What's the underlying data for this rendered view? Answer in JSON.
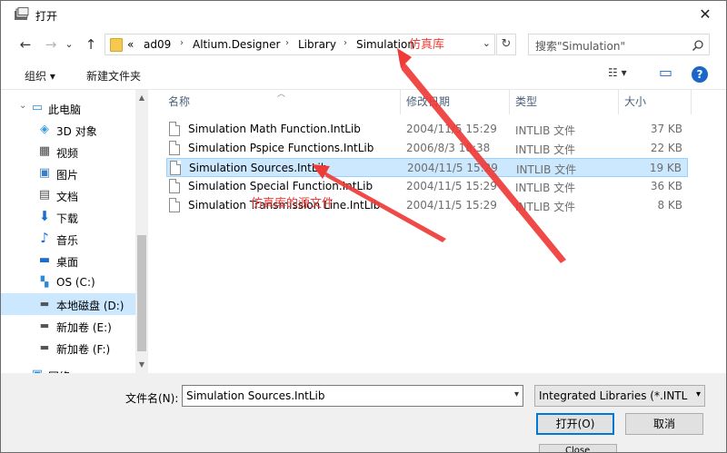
{
  "window": {
    "title": "打开",
    "close_glyph": "✕"
  },
  "nav": {
    "back": "←",
    "forward": "→",
    "history": "⌄",
    "up": "↑",
    "breadcrumb": [
      "«",
      "ad09",
      "Altium.Designer",
      "Library",
      "Simulation"
    ],
    "breadcrumb_sep": "›",
    "refresh": "↻",
    "search_placeholder": "搜索\"Simulation\""
  },
  "toolbar": {
    "organize": "组织 ▾",
    "new_folder": "新建文件夹",
    "view": "☷ ▾",
    "pane": "▭",
    "help": "?"
  },
  "sidebar": {
    "items": [
      {
        "label": "此电脑",
        "icon": "computer-icon"
      },
      {
        "label": "3D 对象",
        "icon": "cube-icon"
      },
      {
        "label": "视频",
        "icon": "film-icon"
      },
      {
        "label": "图片",
        "icon": "picture-icon"
      },
      {
        "label": "文档",
        "icon": "document-icon"
      },
      {
        "label": "下载",
        "icon": "download-icon"
      },
      {
        "label": "音乐",
        "icon": "music-icon"
      },
      {
        "label": "桌面",
        "icon": "desktop-icon"
      },
      {
        "label": "OS (C:)",
        "icon": "windows-drive-icon"
      },
      {
        "label": "本地磁盘 (D:)",
        "icon": "drive-icon"
      },
      {
        "label": "新加卷 (E:)",
        "icon": "drive-icon"
      },
      {
        "label": "新加卷 (F:)",
        "icon": "drive-icon"
      },
      {
        "label": "网络",
        "icon": "network-icon"
      }
    ],
    "selected_index": 9
  },
  "columns": {
    "name": "名称",
    "date": "修改日期",
    "type": "类型",
    "size": "大小"
  },
  "files": [
    {
      "name": "Simulation Math Function.IntLib",
      "date": "2004/11/5 15:29",
      "type": "INTLIB 文件",
      "size": "37 KB"
    },
    {
      "name": "Simulation Pspice Functions.IntLib",
      "date": "2006/8/3 18:38",
      "type": "INTLIB 文件",
      "size": "22 KB"
    },
    {
      "name": "Simulation Sources.IntLib",
      "date": "2004/11/5 15:29",
      "type": "INTLIB 文件",
      "size": "19 KB",
      "selected": true
    },
    {
      "name": "Simulation Special Function.IntLib",
      "date": "2004/11/5 15:29",
      "type": "INTLIB 文件",
      "size": "36 KB"
    },
    {
      "name": "Simulation Transmission Line.IntLib",
      "date": "2004/11/5 15:29",
      "type": "INTLIB 文件",
      "size": "8 KB"
    }
  ],
  "bottom": {
    "filename_label": "文件名(N):",
    "filename_value": "Simulation Sources.IntLib",
    "filter_value": "Integrated Libraries (*.INTLIB",
    "open_button": "打开(O)",
    "cancel_button": "取消",
    "behind_close": "Close"
  },
  "annotations": {
    "folder_note": "仿真库",
    "file_note": "仿真库的源文件",
    "color": "#ee3b37"
  }
}
